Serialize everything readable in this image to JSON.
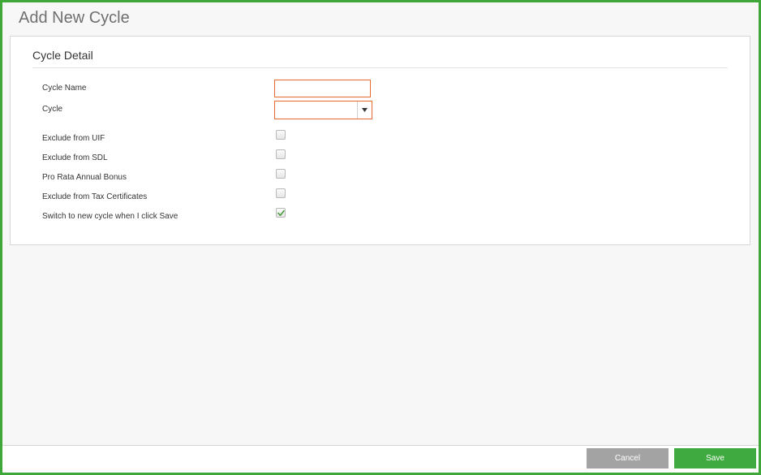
{
  "page": {
    "title": "Add New Cycle"
  },
  "section": {
    "title": "Cycle Detail"
  },
  "fields": {
    "cycle_name": {
      "label": "Cycle Name",
      "value": "",
      "placeholder": ""
    },
    "cycle": {
      "label": "Cycle",
      "selected": ""
    },
    "exclude_uif": {
      "label": "Exclude from UIF",
      "checked": false
    },
    "exclude_sdl": {
      "label": "Exclude from SDL",
      "checked": false
    },
    "pro_rata_bonus": {
      "label": "Pro Rata Annual Bonus",
      "checked": false
    },
    "exclude_tax_certs": {
      "label": "Exclude from Tax Certificates",
      "checked": false
    },
    "switch_new_cycle": {
      "label": "Switch to new cycle when I click Save",
      "checked": true
    }
  },
  "footer": {
    "cancel_label": "Cancel",
    "save_label": "Save"
  },
  "colors": {
    "accent_green": "#3fa63a",
    "required_border": "#e8692e",
    "cancel_gray": "#a3a3a3",
    "checkmark_green": "#4a9a3c"
  }
}
